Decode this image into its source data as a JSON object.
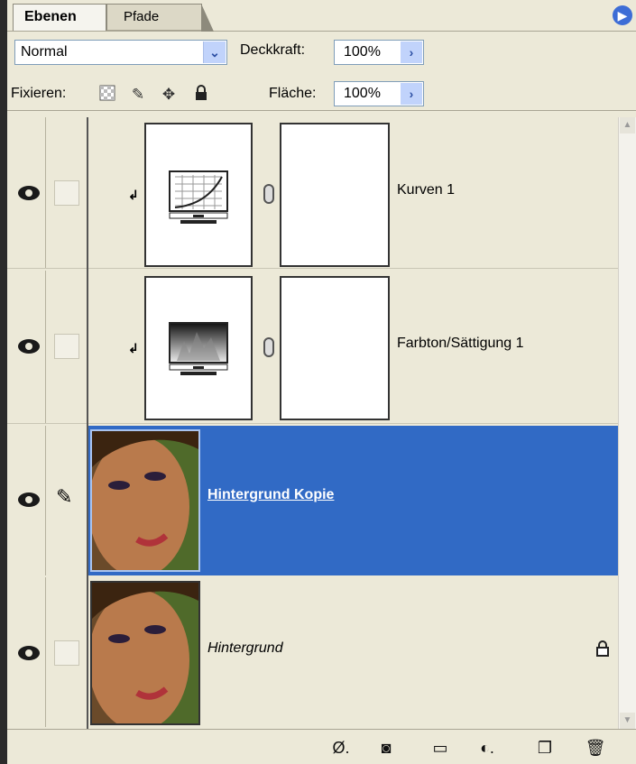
{
  "tabs": [
    {
      "label": "Ebenen",
      "active": true
    },
    {
      "label": "Pfade",
      "active": false
    }
  ],
  "blend_mode": {
    "value": "Normal"
  },
  "opacity": {
    "label": "Deckkraft:",
    "value": "100%"
  },
  "lock": {
    "label": "Fixieren:",
    "icons": [
      "lock-transparency-icon",
      "lock-paint-icon",
      "lock-move-icon",
      "lock-all-icon"
    ]
  },
  "fill": {
    "label": "Fläche:",
    "value": "100%"
  },
  "layers": [
    {
      "name": "Kurven 1",
      "type": "adjustment",
      "icon": "curves-icon",
      "clipped": true,
      "visible": true
    },
    {
      "name": "Farbton/Sättigung 1",
      "type": "adjustment",
      "icon": "hue-saturation-icon",
      "clipped": true,
      "visible": true
    },
    {
      "name": "Hintergrund Kopie",
      "type": "image",
      "selected": true,
      "visible": true
    },
    {
      "name": "Hintergrund",
      "type": "image",
      "locked": true,
      "visible": true
    }
  ],
  "bottom_icons": [
    "link-layers-icon",
    "layer-style-icon",
    "layer-mask-icon",
    "new-group-icon",
    "new-adjustment-icon",
    "new-layer-icon",
    "delete-layer-icon"
  ],
  "colors": {
    "selection": "#316ac5",
    "panel": "#ece9d8"
  }
}
